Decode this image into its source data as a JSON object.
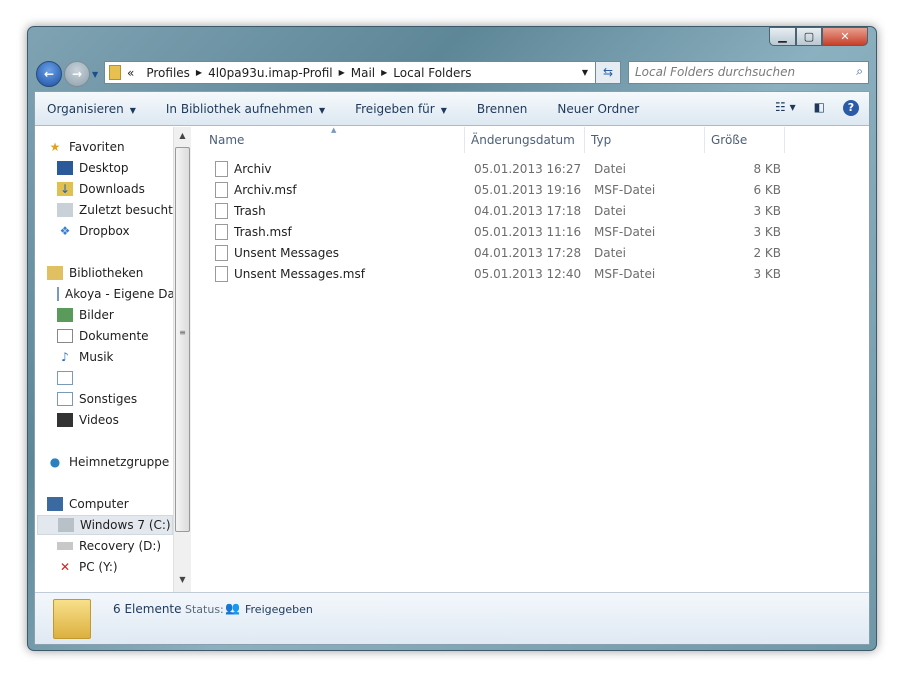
{
  "window": {
    "controls": {
      "minimize": "▁",
      "maximize": "▢",
      "close": "✕"
    }
  },
  "address": {
    "overflow": "«",
    "segments": [
      "Profiles",
      "4l0pa93u.imap-Profil",
      "Mail",
      "Local Folders"
    ]
  },
  "search": {
    "placeholder": "Local Folders durchsuchen"
  },
  "toolbar": {
    "organize": "Organisieren",
    "library": "In Bibliothek aufnehmen",
    "share": "Freigeben für",
    "burn": "Brennen",
    "new_folder": "Neuer Ordner"
  },
  "nav": {
    "favorites": {
      "label": "Favoriten",
      "items": [
        "Desktop",
        "Downloads",
        "Zuletzt besucht",
        "Dropbox"
      ]
    },
    "libraries": {
      "label": "Bibliotheken",
      "items": [
        "Akoya - Eigene Dateien",
        "Bilder",
        "Dokumente",
        "Musik",
        "",
        "Sonstiges",
        "Videos"
      ]
    },
    "homegroup": "Heimnetzgruppe",
    "computer": {
      "label": "Computer",
      "items": [
        "Windows 7 (C:)",
        "Recovery (D:)",
        "PC (Y:)"
      ]
    }
  },
  "columns": {
    "name": "Name",
    "date": "Änderungsdatum",
    "type": "Typ",
    "size": "Größe"
  },
  "files": [
    {
      "name": "Archiv",
      "date": "05.01.2013 16:27",
      "type": "Datei",
      "size": "8 KB"
    },
    {
      "name": "Archiv.msf",
      "date": "05.01.2013 19:16",
      "type": "MSF-Datei",
      "size": "6 KB"
    },
    {
      "name": "Trash",
      "date": "04.01.2013 17:18",
      "type": "Datei",
      "size": "3 KB"
    },
    {
      "name": "Trash.msf",
      "date": "05.01.2013 11:16",
      "type": "MSF-Datei",
      "size": "3 KB"
    },
    {
      "name": "Unsent Messages",
      "date": "04.01.2013 17:28",
      "type": "Datei",
      "size": "2 KB"
    },
    {
      "name": "Unsent Messages.msf",
      "date": "05.01.2013 12:40",
      "type": "MSF-Datei",
      "size": "3 KB"
    }
  ],
  "details": {
    "count": "6 Elemente",
    "status_label": "Status:",
    "status": "Freigegeben"
  }
}
